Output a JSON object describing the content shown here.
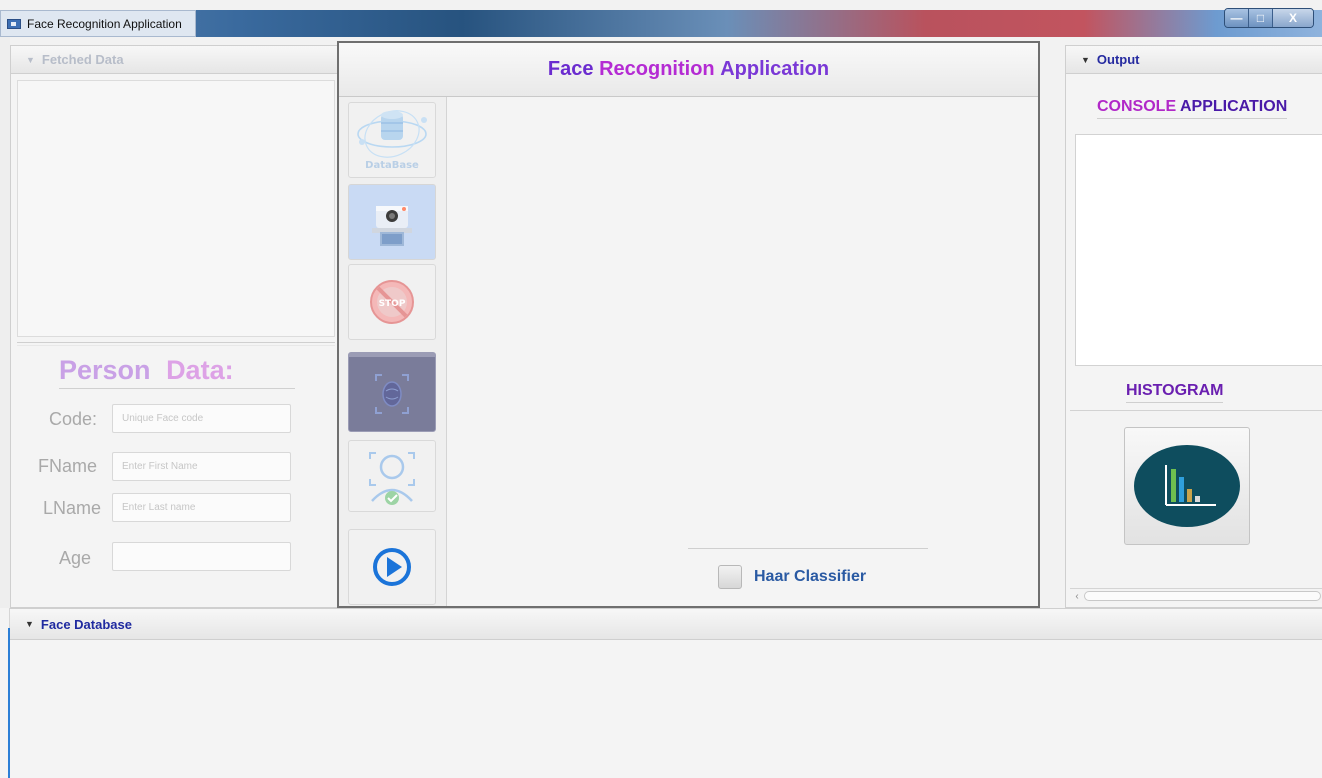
{
  "window": {
    "title": "Face Recognition Application",
    "controls": {
      "minimize": "—",
      "maximize": "□",
      "close": "X"
    }
  },
  "left_panel": {
    "fetched_header": "Fetched Data",
    "person_title_1": "Person",
    "person_title_2": "Data:",
    "fields": [
      {
        "label": "Code:",
        "placeholder": "Unique Face code",
        "value": ""
      },
      {
        "label": "FName",
        "placeholder": "Enter First Name",
        "value": ""
      },
      {
        "label": "LName",
        "placeholder": "Enter Last name",
        "value": ""
      },
      {
        "label": "Age",
        "placeholder": "",
        "value": ""
      }
    ]
  },
  "center_panel": {
    "title_word1": "Face",
    "title_word2": "Recognition",
    "title_word3": "Application",
    "database_icon_text": "DataBase",
    "stop_icon_text": "STOP",
    "haar_label": "Haar Classifier"
  },
  "right_panel": {
    "output_header": "Output",
    "console_title_1": "CONSOLE",
    "console_title_2": "APPLICATION",
    "histogram_title": "HISTOGRAM",
    "scroll_left": "‹"
  },
  "bottom_panel": {
    "header": "Face Database"
  },
  "colors": {
    "accent_purple": "#6b2ccf",
    "accent_magenta": "#b42bd3",
    "haar_blue": "#2a5aa3",
    "play_blue": "#1b74d9",
    "histogram_bg": "#0e4d5e"
  }
}
